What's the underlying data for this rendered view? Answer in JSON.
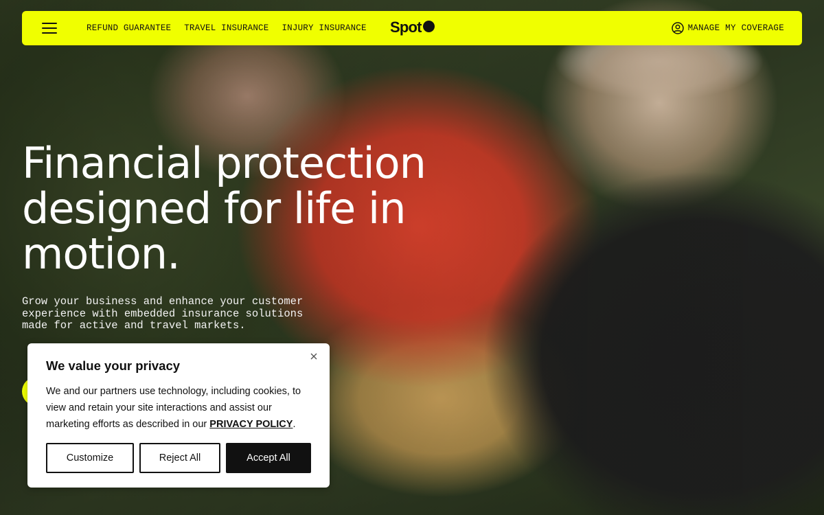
{
  "nav": {
    "links": [
      "REFUND GUARANTEE",
      "TRAVEL INSURANCE",
      "INJURY INSURANCE"
    ],
    "logo_text": "Spot",
    "manage_label": "MANAGE MY COVERAGE"
  },
  "hero": {
    "title": "Financial protection designed for life in motion.",
    "subtitle": "Grow your business and enhance your customer experience with embedded insurance solutions made for active and travel markets."
  },
  "cookie": {
    "title": "We value your privacy",
    "body": "We and our partners use technology, including cookies, to view and retain your site interactions and assist our marketing efforts as described in our ",
    "link_label": "PRIVACY POLICY",
    "body_end": ".",
    "buttons": {
      "customize": "Customize",
      "reject": "Reject All",
      "accept": "Accept All"
    }
  },
  "colors": {
    "accent": "#f0ff00",
    "dark": "#111111",
    "white": "#ffffff"
  },
  "icons": {
    "menu": "hamburger-menu-icon",
    "user": "user-circle-icon",
    "close": "close-icon"
  }
}
